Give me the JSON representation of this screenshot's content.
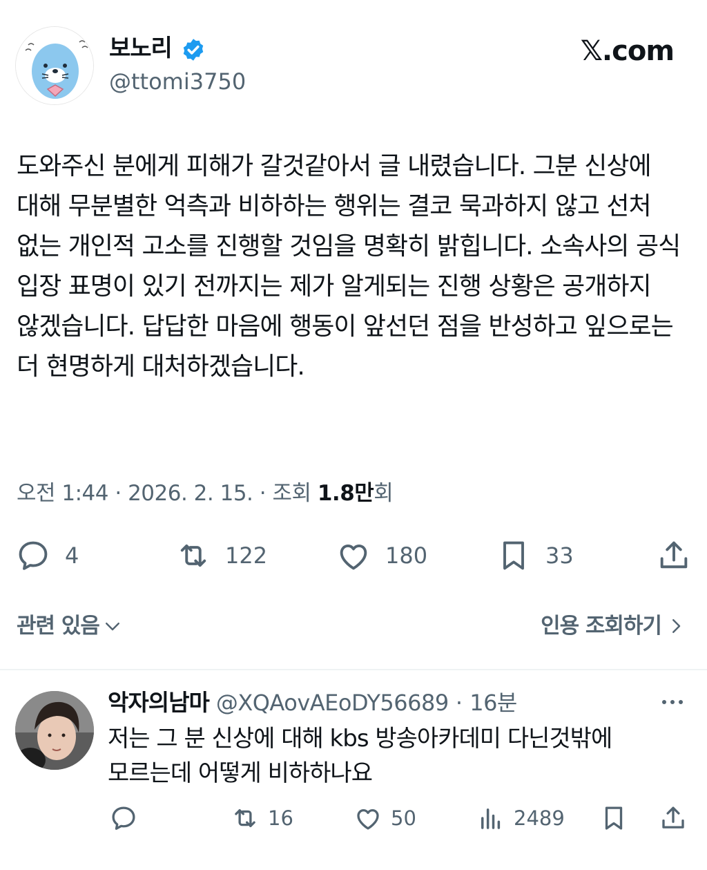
{
  "header": {
    "display_name": "보노리",
    "handle": "@ttomi3750",
    "brand": "𝕏.com"
  },
  "tweet": {
    "text": "도와주신 분에게 피해가 갈것같아서 글 내렸습니다. 그분 신상에 대해 무분별한 억측과  비하하는 행위는 결코 묵과하지 않고 선처 없는 개인적 고소를 진행할 것임을 명확히 밝힙니다. 소속사의 공식 입장 표명이 있기 전까지는 제가 알게되는 진행 상황은 공개하지 않겠습니다. 답답한 마음에 행동이 앞선던 점을 반성하고 잎으로는 더 현명하게 대처하겠습니다.",
    "meta_time": "오전 1:44 · 2026. 2. 15. · 조회 ",
    "meta_views": "1.8만",
    "meta_views_unit": "회"
  },
  "actions": {
    "replies": "4",
    "retweets": "122",
    "likes": "180",
    "bookmarks": "33"
  },
  "related": {
    "left_label": "관련 있음",
    "right_label": "인용 조회하기"
  },
  "reply": {
    "name": "악자의남마",
    "handle": "@XQAovAEoDY56689",
    "dot": " · ",
    "time": "16분",
    "text": "저는 그 분 신상에 대해 kbs 방송아카데미 다닌것밖에 모르는데 어떻게 비하하나요",
    "retweets": "16",
    "likes": "50",
    "views": "2489"
  },
  "colors": {
    "text": "#0f1419",
    "secondary": "#536471",
    "verified": "#1d9bf0"
  }
}
